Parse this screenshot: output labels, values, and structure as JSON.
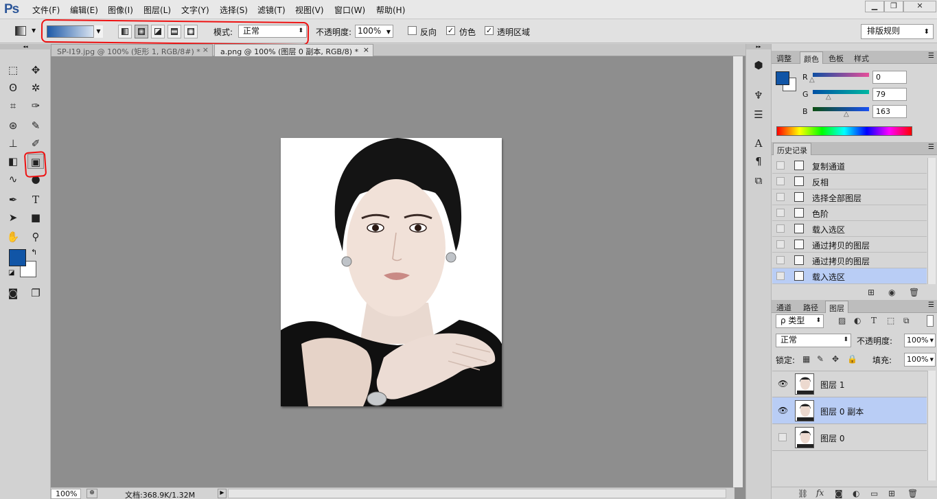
{
  "app": {
    "logo": "Ps"
  },
  "menu": [
    "文件(F)",
    "编辑(E)",
    "图像(I)",
    "图层(L)",
    "文字(Y)",
    "选择(S)",
    "滤镜(T)",
    "视图(V)",
    "窗口(W)",
    "帮助(H)"
  ],
  "window_controls": {
    "minimize": "▁",
    "restore": "❐",
    "close": "✕"
  },
  "options": {
    "mode_label": "模式:",
    "mode_value": "正常",
    "opacity_label": "不透明度:",
    "opacity_value": "100%",
    "reverse_label": "反向",
    "dither_label": "仿色",
    "transparency_label": "透明区域",
    "reverse_checked": false,
    "dither_checked": true,
    "transparency_checked": true,
    "workspace": "排版规则",
    "gradient_colors": [
      "#1e5aa8",
      "#ffffff"
    ]
  },
  "tabs": [
    {
      "label": "SP-I19.jpg @ 100% (矩形 1, RGB/8#) *",
      "close": "×"
    },
    {
      "label": "a.png @ 100% (图层 0 副本, RGB/8) *",
      "close": "×"
    }
  ],
  "status": {
    "zoom": "100%",
    "doc": "文档:368.9K/1.32M"
  },
  "tools": {
    "foreground_color": "#1155a6",
    "background_color": "#ffffff"
  },
  "color_panel": {
    "tabs": [
      "调整",
      "颜色",
      "色板",
      "样式"
    ],
    "active_tab": "颜色",
    "channels": [
      {
        "name": "R",
        "value": "0"
      },
      {
        "name": "G",
        "value": "79"
      },
      {
        "name": "B",
        "value": "163"
      }
    ]
  },
  "history_panel": {
    "title": "历史记录",
    "items": [
      "复制通道",
      "反相",
      "选择全部图层",
      "色阶",
      "载入选区",
      "通过拷贝的图层",
      "通过拷贝的图层",
      "载入选区"
    ]
  },
  "layers_panel": {
    "tabs": [
      "通道",
      "路径",
      "图层"
    ],
    "active_tab": "图层",
    "filter_label": "ρ 类型",
    "blend_mode": "正常",
    "opacity_label": "不透明度:",
    "opacity": "100%",
    "lock_label": "锁定:",
    "fill_label": "填充:",
    "fill": "100%",
    "layers": [
      {
        "name": "图层 1",
        "visible": true,
        "selected": false
      },
      {
        "name": "图层 0 副本",
        "visible": true,
        "selected": true
      },
      {
        "name": "图层 0",
        "visible": false,
        "selected": false
      }
    ]
  },
  "colors": {
    "selection": "#b9cdf5",
    "annotation": "#e11111"
  }
}
